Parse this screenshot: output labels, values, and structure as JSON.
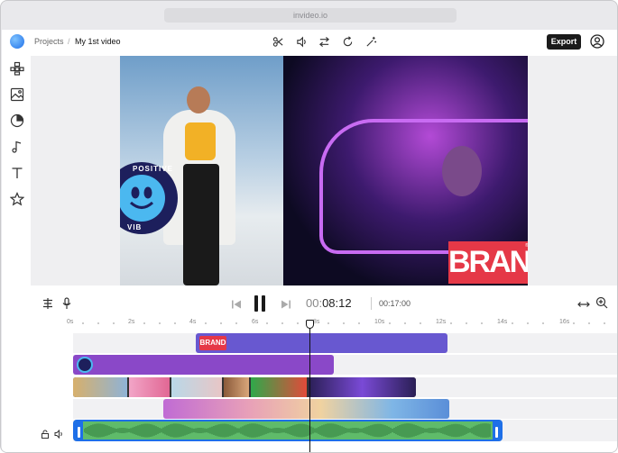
{
  "browser": {
    "url": "invideo.io"
  },
  "header": {
    "breadcrumb_root": "Projects",
    "breadcrumb_sep": "/",
    "project_title": "My 1st video",
    "export_label": "Export",
    "tools": [
      "scissors-icon",
      "volume-icon",
      "swap-icon",
      "rotate-icon",
      "magic-wand-icon"
    ]
  },
  "sidebar": {
    "items": [
      "layouts-icon",
      "media-icon",
      "stickers-icon",
      "music-icon",
      "text-icon",
      "favorites-icon"
    ]
  },
  "preview": {
    "sticker_text_top": "POSITIVE",
    "sticker_text_left": "VIB",
    "brand_text": "BRAND",
    "brand_mark": "®"
  },
  "player": {
    "time_prefix": "00:",
    "time_current": "08:12",
    "duration": "00:17:00"
  },
  "ruler": {
    "labels": [
      "0s",
      "2s",
      "4s",
      "6s",
      "8s",
      "10s",
      "12s",
      "14s",
      "16s"
    ]
  },
  "colors": {
    "accent": "#1e6fe8",
    "text_clip": "#6858d0",
    "sticker_clip": "#8a48c8",
    "audio_clip": "#5fbb6a",
    "brand_red": "#e53847"
  }
}
